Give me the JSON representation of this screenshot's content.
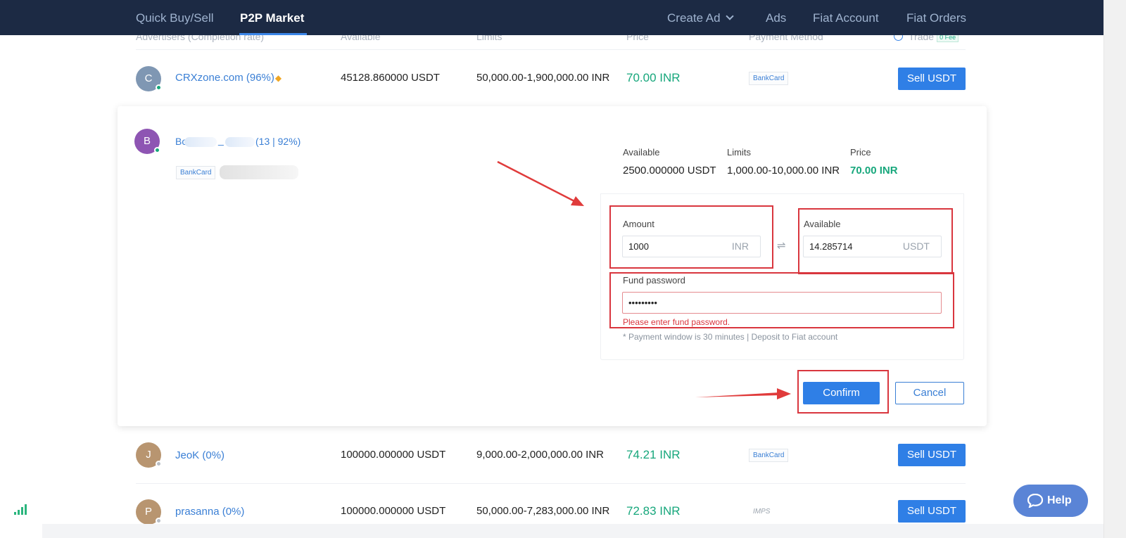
{
  "nav": {
    "quick_buy_sell": "Quick Buy/Sell",
    "p2p_market": "P2P Market",
    "create_ad": "Create Ad",
    "ads": "Ads",
    "fiat_account": "Fiat Account",
    "fiat_orders": "Fiat Orders"
  },
  "table": {
    "headers": {
      "advertisers": "Advertisers (Completion rate)",
      "available": "Available",
      "limits": "Limits",
      "price": "Price",
      "payment_method": "Payment Method",
      "trade": "Trade",
      "fee_badge": "0 Fee"
    },
    "rows": [
      {
        "initial": "C",
        "name": "CRXzone.com (96%)",
        "available": "45128.860000 USDT",
        "limits": "50,000.00-1,900,000.00 INR",
        "price": "70.00 INR",
        "payment": "BankCard",
        "action": "Sell USDT"
      },
      {
        "initial": "J",
        "name": "JeoK (0%)",
        "available": "100000.000000 USDT",
        "limits": "9,000.00-2,000,000.00 INR",
        "price": "74.21 INR",
        "payment": "BankCard",
        "action": "Sell USDT"
      },
      {
        "initial": "P",
        "name": "prasanna (0%)",
        "available": "100000.000000 USDT",
        "limits": "50,000.00-7,283,000.00 INR",
        "price": "72.83 INR",
        "payment": "IMPS",
        "action": "Sell USDT"
      }
    ]
  },
  "expanded": {
    "initial": "B",
    "name_prefix": "Bo",
    "name_mid": "_",
    "stats": "(13 | 92%)",
    "payment": "BankCard",
    "summary": {
      "available_label": "Available",
      "available_value": "2500.000000 USDT",
      "limits_label": "Limits",
      "limits_value": "1,000.00-10,000.00 INR",
      "price_label": "Price",
      "price_value": "70.00 INR"
    },
    "amount_label": "Amount",
    "amount_value": "1000",
    "amount_unit": "INR",
    "available_label": "Available",
    "available_value": "14.285714",
    "available_unit": "USDT",
    "swap_symbol": "⇌",
    "fund_password_label": "Fund password",
    "fund_password_value": "•••••••••",
    "error": "Please enter fund password.",
    "note": "* Payment window is 30 minutes  |  Deposit to Fiat account",
    "confirm": "Confirm",
    "cancel": "Cancel"
  },
  "help": "Help",
  "colors": {
    "nav_bg": "#1c2a44",
    "accent": "#2f7fe6",
    "price_green": "#17a77c",
    "annotation_red": "#d9363e"
  }
}
